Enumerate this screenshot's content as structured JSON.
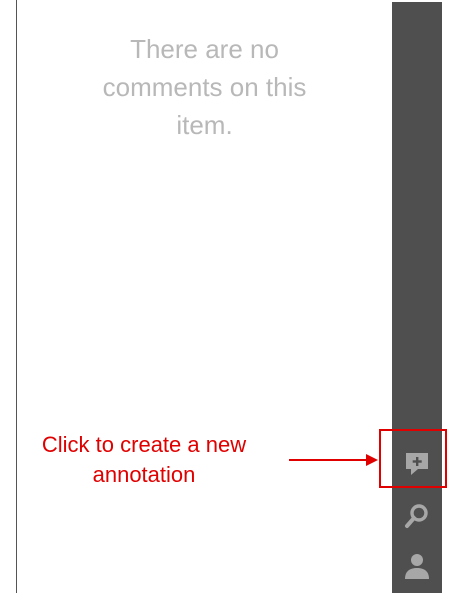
{
  "comments": {
    "empty_message": "There are no comments on this item."
  },
  "toolbar": {
    "buttons": [
      {
        "name": "new-annotation",
        "icon": "comment-plus-icon"
      },
      {
        "name": "search",
        "icon": "search-icon"
      },
      {
        "name": "account",
        "icon": "user-icon"
      }
    ]
  },
  "callout": {
    "text": "Click to create a new annotation",
    "color": "#e00000"
  },
  "colors": {
    "toolbar_bg": "#4f4f4f",
    "icon": "#a7a7a7",
    "empty_text": "#b8b8b8"
  }
}
